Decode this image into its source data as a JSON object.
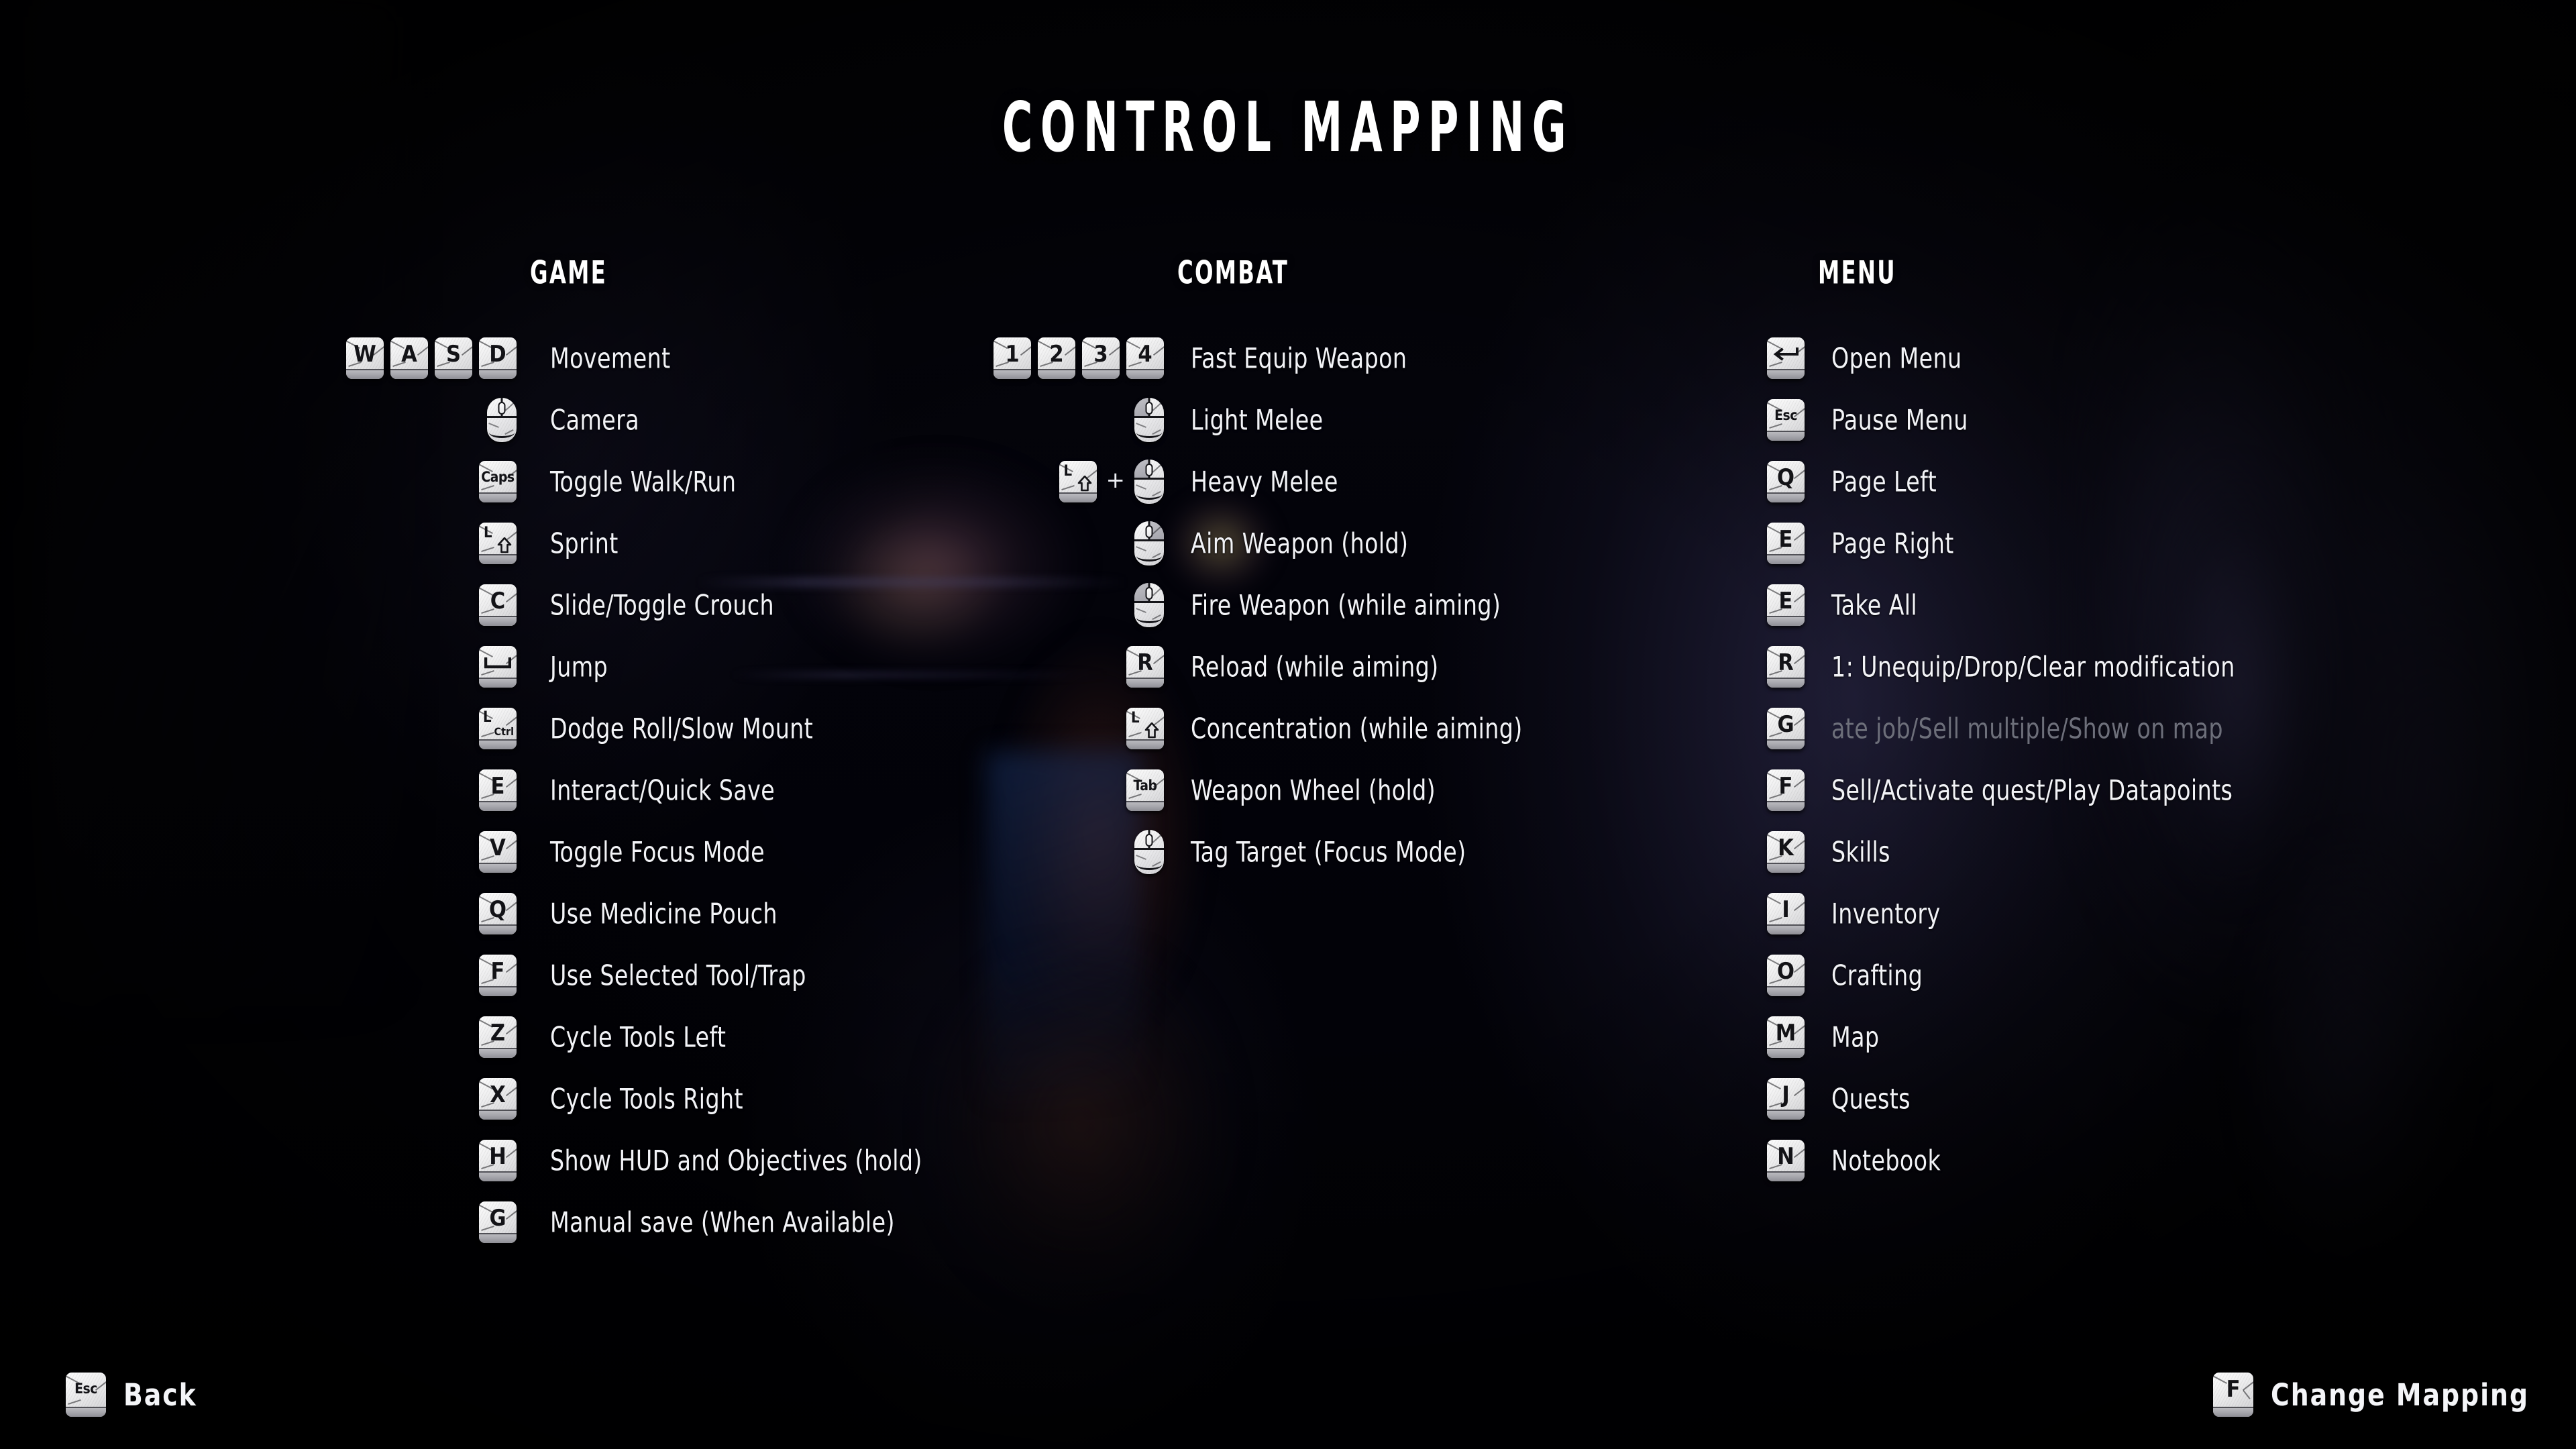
{
  "title": "CONTROL MAPPING",
  "columns": [
    {
      "id": "game",
      "heading": "GAME",
      "rows": [
        {
          "keys": [
            {
              "type": "key",
              "label": "W"
            },
            {
              "type": "key",
              "label": "A"
            },
            {
              "type": "key",
              "label": "S"
            },
            {
              "type": "key",
              "label": "D"
            }
          ],
          "action": "Movement"
        },
        {
          "keys": [
            {
              "type": "mouse",
              "button": "move",
              "label": "mouse-move"
            }
          ],
          "action": "Camera"
        },
        {
          "keys": [
            {
              "type": "key",
              "label": "Caps",
              "size": "sm"
            }
          ],
          "action": "Toggle Walk/Run"
        },
        {
          "keys": [
            {
              "type": "key",
              "label": "L Shift",
              "glyph": "shift"
            }
          ],
          "action": "Sprint"
        },
        {
          "keys": [
            {
              "type": "key",
              "label": "C"
            }
          ],
          "action": "Slide/Toggle Crouch"
        },
        {
          "keys": [
            {
              "type": "key",
              "label": "Space",
              "glyph": "space"
            }
          ],
          "action": "Jump"
        },
        {
          "keys": [
            {
              "type": "key",
              "label": "L Ctrl",
              "glyph": "ctrl"
            }
          ],
          "action": "Dodge Roll/Slow Mount"
        },
        {
          "keys": [
            {
              "type": "key",
              "label": "E"
            }
          ],
          "action": "Interact/Quick Save"
        },
        {
          "keys": [
            {
              "type": "key",
              "label": "V"
            }
          ],
          "action": "Toggle Focus Mode"
        },
        {
          "keys": [
            {
              "type": "key",
              "label": "Q"
            }
          ],
          "action": "Use Medicine Pouch"
        },
        {
          "keys": [
            {
              "type": "key",
              "label": "F"
            }
          ],
          "action": "Use Selected Tool/Trap"
        },
        {
          "keys": [
            {
              "type": "key",
              "label": "Z"
            }
          ],
          "action": "Cycle Tools Left"
        },
        {
          "keys": [
            {
              "type": "key",
              "label": "X"
            }
          ],
          "action": "Cycle Tools Right"
        },
        {
          "keys": [
            {
              "type": "key",
              "label": "H"
            }
          ],
          "action": "Show HUD and Objectives (hold)"
        },
        {
          "keys": [
            {
              "type": "key",
              "label": "G"
            }
          ],
          "action": "Manual save (When Available)"
        }
      ]
    },
    {
      "id": "combat",
      "heading": "COMBAT",
      "rows": [
        {
          "keys": [
            {
              "type": "key",
              "label": "1"
            },
            {
              "type": "key",
              "label": "2"
            },
            {
              "type": "key",
              "label": "3"
            },
            {
              "type": "key",
              "label": "4"
            }
          ],
          "action": "Fast Equip Weapon"
        },
        {
          "keys": [
            {
              "type": "mouse",
              "button": "left",
              "label": "mouse-left-click"
            }
          ],
          "action": "Light Melee"
        },
        {
          "keys": [
            {
              "type": "key",
              "label": "L Shift",
              "glyph": "shift"
            },
            {
              "type": "plus",
              "label": "+"
            },
            {
              "type": "mouse",
              "button": "left",
              "label": "mouse-left-click"
            }
          ],
          "action": "Heavy Melee"
        },
        {
          "keys": [
            {
              "type": "mouse",
              "button": "right",
              "label": "mouse-right-click"
            }
          ],
          "action": "Aim Weapon (hold)"
        },
        {
          "keys": [
            {
              "type": "mouse",
              "button": "left",
              "label": "mouse-left-click"
            }
          ],
          "action": "Fire Weapon (while aiming)"
        },
        {
          "keys": [
            {
              "type": "key",
              "label": "R"
            }
          ],
          "action": "Reload (while aiming)"
        },
        {
          "keys": [
            {
              "type": "key",
              "label": "L Shift",
              "glyph": "shift"
            }
          ],
          "action": "Concentration (while aiming)"
        },
        {
          "keys": [
            {
              "type": "key",
              "label": "Tab",
              "size": "sm"
            }
          ],
          "action": "Weapon Wheel (hold)"
        },
        {
          "keys": [
            {
              "type": "mouse",
              "button": "middle",
              "label": "mouse-middle-click"
            }
          ],
          "action": "Tag Target (Focus Mode)"
        }
      ]
    },
    {
      "id": "menu",
      "heading": "MENU",
      "rows": [
        {
          "keys": [
            {
              "type": "key",
              "label": "Enter",
              "glyph": "enter"
            }
          ],
          "action": "Open Menu"
        },
        {
          "keys": [
            {
              "type": "key",
              "label": "Esc",
              "size": "sm"
            }
          ],
          "action": "Pause Menu"
        },
        {
          "keys": [
            {
              "type": "key",
              "label": "Q"
            }
          ],
          "action": "Page Left"
        },
        {
          "keys": [
            {
              "type": "key",
              "label": "E"
            }
          ],
          "action": "Page Right"
        },
        {
          "keys": [
            {
              "type": "key",
              "label": "E"
            }
          ],
          "action": "Take All"
        },
        {
          "keys": [
            {
              "type": "key",
              "label": "R"
            }
          ],
          "action": "1: Unequip/Drop/Clear modification"
        },
        {
          "keys": [
            {
              "type": "key",
              "label": "G"
            }
          ],
          "action": "ate job/Sell multiple/Show on map",
          "dim": true
        },
        {
          "keys": [
            {
              "type": "key",
              "label": "F"
            }
          ],
          "action": "Sell/Activate quest/Play Datapoints"
        },
        {
          "keys": [
            {
              "type": "key",
              "label": "K"
            }
          ],
          "action": "Skills"
        },
        {
          "keys": [
            {
              "type": "key",
              "label": "I"
            }
          ],
          "action": "Inventory"
        },
        {
          "keys": [
            {
              "type": "key",
              "label": "O"
            }
          ],
          "action": "Crafting"
        },
        {
          "keys": [
            {
              "type": "key",
              "label": "M"
            }
          ],
          "action": "Map"
        },
        {
          "keys": [
            {
              "type": "key",
              "label": "J"
            }
          ],
          "action": "Quests"
        },
        {
          "keys": [
            {
              "type": "key",
              "label": "N"
            }
          ],
          "action": "Notebook"
        }
      ]
    }
  ],
  "footer": {
    "back": {
      "key": "Esc",
      "label": "Back"
    },
    "change_mapping": {
      "key": "F",
      "label": "Change Mapping"
    }
  },
  "colors": {
    "background": "#020208",
    "text": "#f2f3f7",
    "text_dim": "#6d6f7a",
    "keycap": "#ededee",
    "keycap_glyph": "#131317"
  }
}
